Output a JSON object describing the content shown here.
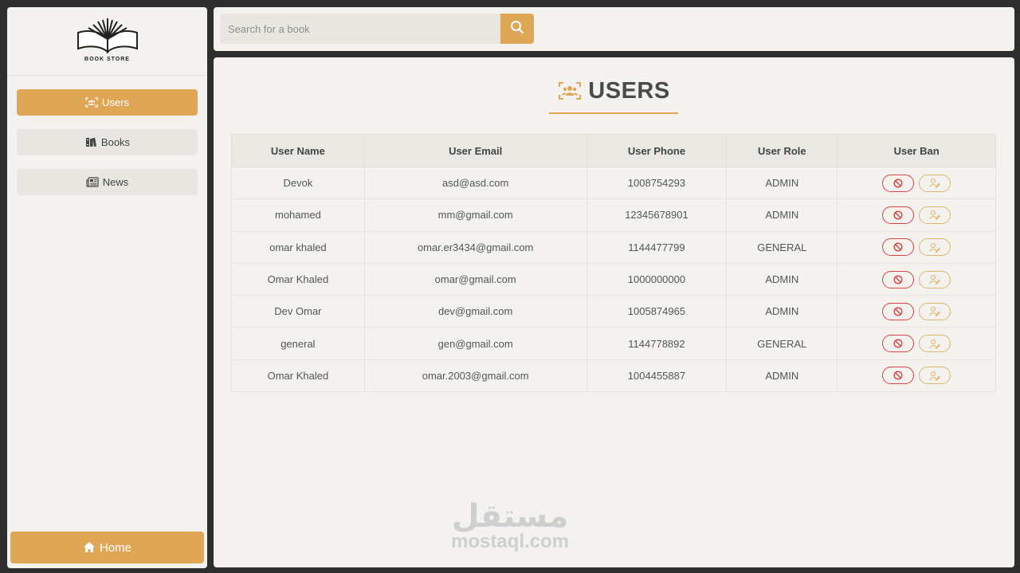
{
  "sidebar": {
    "logo_text": "BOOK STORE",
    "items": [
      {
        "label": "Users",
        "icon": "users-icon",
        "active": true
      },
      {
        "label": "Books",
        "icon": "books-icon",
        "active": false
      },
      {
        "label": "News",
        "icon": "newspaper-icon",
        "active": false
      }
    ],
    "home_label": "Home"
  },
  "search": {
    "placeholder": "Search for a book",
    "value": ""
  },
  "page": {
    "title": "USERS"
  },
  "table": {
    "headers": [
      "User Name",
      "User Email",
      "User Phone",
      "User Role",
      "User Ban"
    ],
    "rows": [
      {
        "name": "Devok",
        "email": "asd@asd.com",
        "phone": "1008754293",
        "role": "ADMIN"
      },
      {
        "name": "mohamed",
        "email": "mm@gmail.com",
        "phone": "12345678901",
        "role": "ADMIN"
      },
      {
        "name": "omar khaled",
        "email": "omar.er3434@gmail.com",
        "phone": "1144477799",
        "role": "GENERAL"
      },
      {
        "name": "Omar Khaled",
        "email": "omar@gmail.com",
        "phone": "1000000000",
        "role": "ADMIN"
      },
      {
        "name": "Dev Omar",
        "email": "dev@gmail.com",
        "phone": "1005874965",
        "role": "ADMIN"
      },
      {
        "name": "general",
        "email": "gen@gmail.com",
        "phone": "1144778892",
        "role": "GENERAL"
      },
      {
        "name": "Omar Khaled",
        "email": "omar.2003@gmail.com",
        "phone": "1004455887",
        "role": "ADMIN"
      }
    ]
  },
  "watermark": {
    "arabic": "مستقل",
    "latin": "mostaql.com"
  },
  "colors": {
    "accent": "#dfa655",
    "ban": "#d9413f",
    "edit": "#dfb56a"
  }
}
